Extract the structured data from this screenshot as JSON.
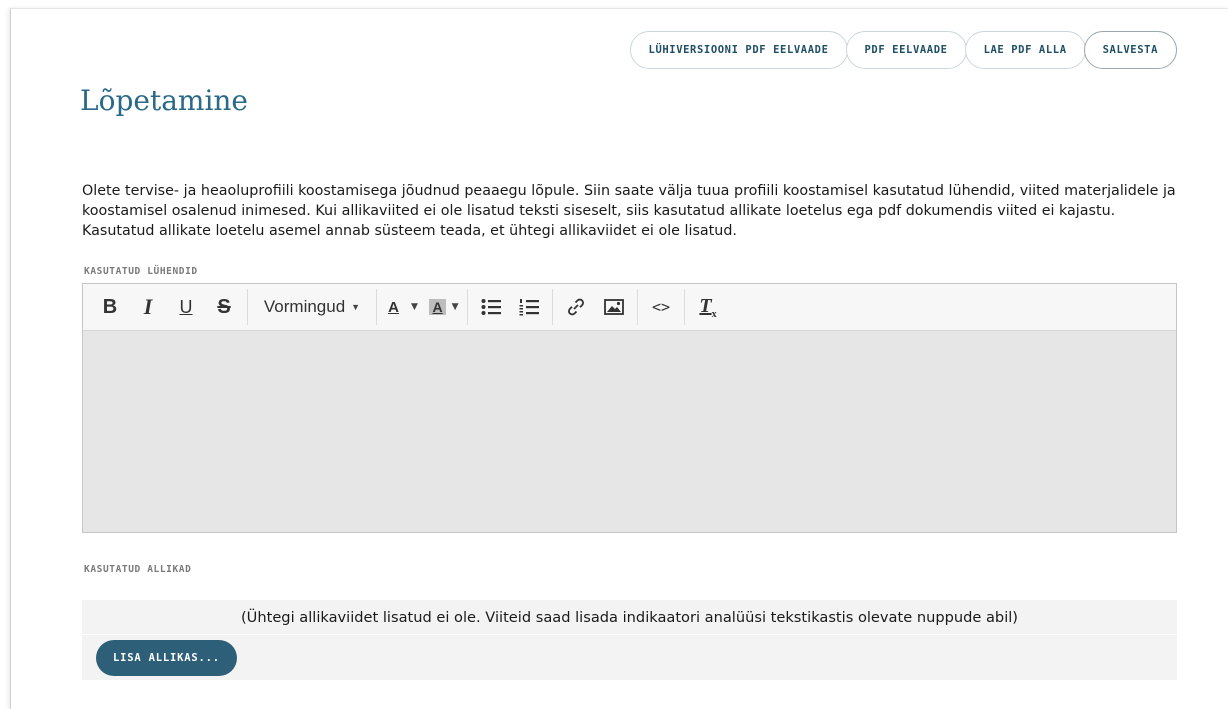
{
  "actions": {
    "short_pdf_preview": "LÜHIVERSIOONI PDF EELVAADE",
    "pdf_preview": "PDF EELVAADE",
    "download_pdf": "LAE PDF ALLA",
    "save": "SALVESTA"
  },
  "page": {
    "title": "Lõpetamine",
    "intro": "Olete tervise- ja heaoluprofiili koostamisega jõudnud peaaegu lõpule. Siin saate välja tuua profiili koostamisel kasutatud lühendid, viited materjalidele ja koostamisel osalenud inimesed. Kui allikaviited ei ole lisatud teksti siseselt, siis kasutatud allikate loetelus ega pdf dokumendis viited ei kajastu. Kasutatud allikate loetelu asemel annab süsteem teada, et ühtegi allikaviidet ei ole lisatud."
  },
  "abbreviations": {
    "label": "KASUTATUD LÜHENDID",
    "toolbar": {
      "bold": "B",
      "italic": "I",
      "underline": "U",
      "strikethrough": "S",
      "formats": "Vormingud",
      "text_color": "A",
      "bg_color": "A",
      "clear_format": "T",
      "clear_sub": "x",
      "code": "<>"
    },
    "content": ""
  },
  "sources": {
    "label": "KASUTATUD ALLIKAD",
    "empty_message": "(Ühtegi allikaviidet lisatud ei ole. Viiteid saad lisada indikaatori analüüsi tekstikastis olevate nuppude abil)",
    "add_button": "LISA ALLIKAS..."
  },
  "colors": {
    "title": "#2a6a88",
    "primary_button": "#2d5f78",
    "editor_bg": "#e6e6e6"
  },
  "icons": [
    "bullet-list-icon",
    "numbered-list-icon",
    "link-icon",
    "image-icon",
    "code-icon",
    "clear-format-icon",
    "caret-down-icon"
  ]
}
